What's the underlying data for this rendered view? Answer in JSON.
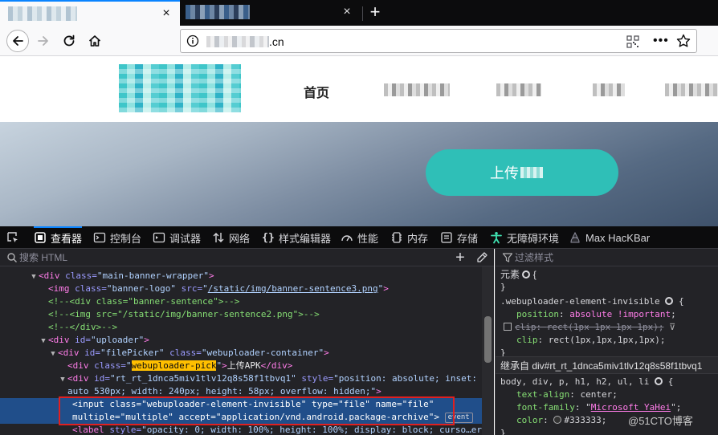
{
  "browser": {
    "tab_close_glyph": "×",
    "new_tab_glyph": "+",
    "url_host_suffix": ".cn",
    "url_menu_glyph": "•••"
  },
  "site": {
    "nav_home": "首页",
    "upload_button": "上传"
  },
  "devtools": {
    "tabs": [
      {
        "label": "查看器",
        "icon": "inspector-icon"
      },
      {
        "label": "控制台",
        "icon": "console-icon"
      },
      {
        "label": "调试器",
        "icon": "debugger-icon"
      },
      {
        "label": "网络",
        "icon": "network-icon"
      },
      {
        "label": "样式编辑器",
        "icon": "style-editor-icon"
      },
      {
        "label": "性能",
        "icon": "performance-icon"
      },
      {
        "label": "内存",
        "icon": "memory-icon"
      },
      {
        "label": "存储",
        "icon": "storage-icon"
      },
      {
        "label": "无障碍环境",
        "icon": "accessibility-icon"
      },
      {
        "label": "Max HacKBar",
        "icon": "hackbar-icon"
      }
    ],
    "search_placeholder": "搜索 HTML",
    "filter_placeholder": "过滤样式",
    "markup": {
      "l1": {
        "tag": "<div ",
        "a1": "class=",
        "v1": "\"main-banner-wrapper\"",
        "end": ">"
      },
      "l2": {
        "tag": "<img ",
        "a1": "class=",
        "v1": "\"banner-logo\"",
        "a2": " src=",
        "q1": "\"",
        "v2": "/static/img/banner-sentence3.png",
        "q2": "\"",
        "end": ">"
      },
      "l3": "<!--<div class=\"banner-sentence\">-->",
      "l4": "<!--<img src=\"/static/img/banner-sentence2.png\">-->",
      "l5": "<!--</div>-->",
      "l6": {
        "tag": "<div ",
        "a1": "id=",
        "v1": "\"uploader\"",
        "end": ">"
      },
      "l7": {
        "tag": "<div ",
        "a1": "id=",
        "v1": "\"filePicker\"",
        "a2": " class=",
        "v2": "\"webuploader-container\"",
        "end": ">"
      },
      "l8": {
        "tag": "<div ",
        "a1": "class=",
        "q1": "\"",
        "v1": "webuploader-pick",
        "q2": "\"",
        "close": ">",
        "text": "上传APK",
        "end": "</div>"
      },
      "l9": {
        "tag": "<div ",
        "a1": "id=",
        "v1": "\"rt_rt_1dnca5miv1tlv12q8s58f1tbvq1\"",
        "a2": " style=",
        "v2": "\"position: absolute; inset: 0px auto"
      },
      "l10": {
        "v": "auto 530px; width: 240px; height: 58px; overflow: hidden;\"",
        "end": ">"
      },
      "l11": {
        "tag": "<input ",
        "a1": "class=",
        "v1": "\"webuploader-element-invisible\"",
        "a2": " type=",
        "v2": "\"file\"",
        "a3": " name=",
        "v3": "\"file\""
      },
      "l12": {
        "a1": "multiple=",
        "v1": "\"multiple\"",
        "a2": " accept=",
        "v2": "\"application/vnd.android.package-archive\"",
        "end": ">",
        "badge": "event"
      },
      "l13": {
        "tag": "<label ",
        "a1": "style=",
        "v1": "\"opacity: 0; width: 100%; height: 100%; display: block; curso…er;"
      }
    },
    "rules": {
      "element_header": "元素",
      "open_brace": "{",
      "close_brace": "}",
      "rule_selector": ".webuploader-element-invisible",
      "decl1_name": "position",
      "decl1_value": "absolute !important",
      "decl2_name": "clip",
      "decl2_value": "rect(1px 1px 1px 1px)",
      "decl3_name": "clip",
      "decl3_value": "rect(1px,1px,1px,1px)",
      "inherited_header": "继承自 div#rt_rt_1dnca5miv1tlv12q8s58f1tbvq1",
      "inherited_selector": "body, div, p, h1, h2, ul, li",
      "decl4_name": "text-align",
      "decl4_value": "center",
      "decl5_name": "font-family",
      "decl5_value": "Microsoft YaHei",
      "decl6_name": "color",
      "decl6_value": "#333333"
    },
    "watermark": "@51CTO博客"
  }
}
